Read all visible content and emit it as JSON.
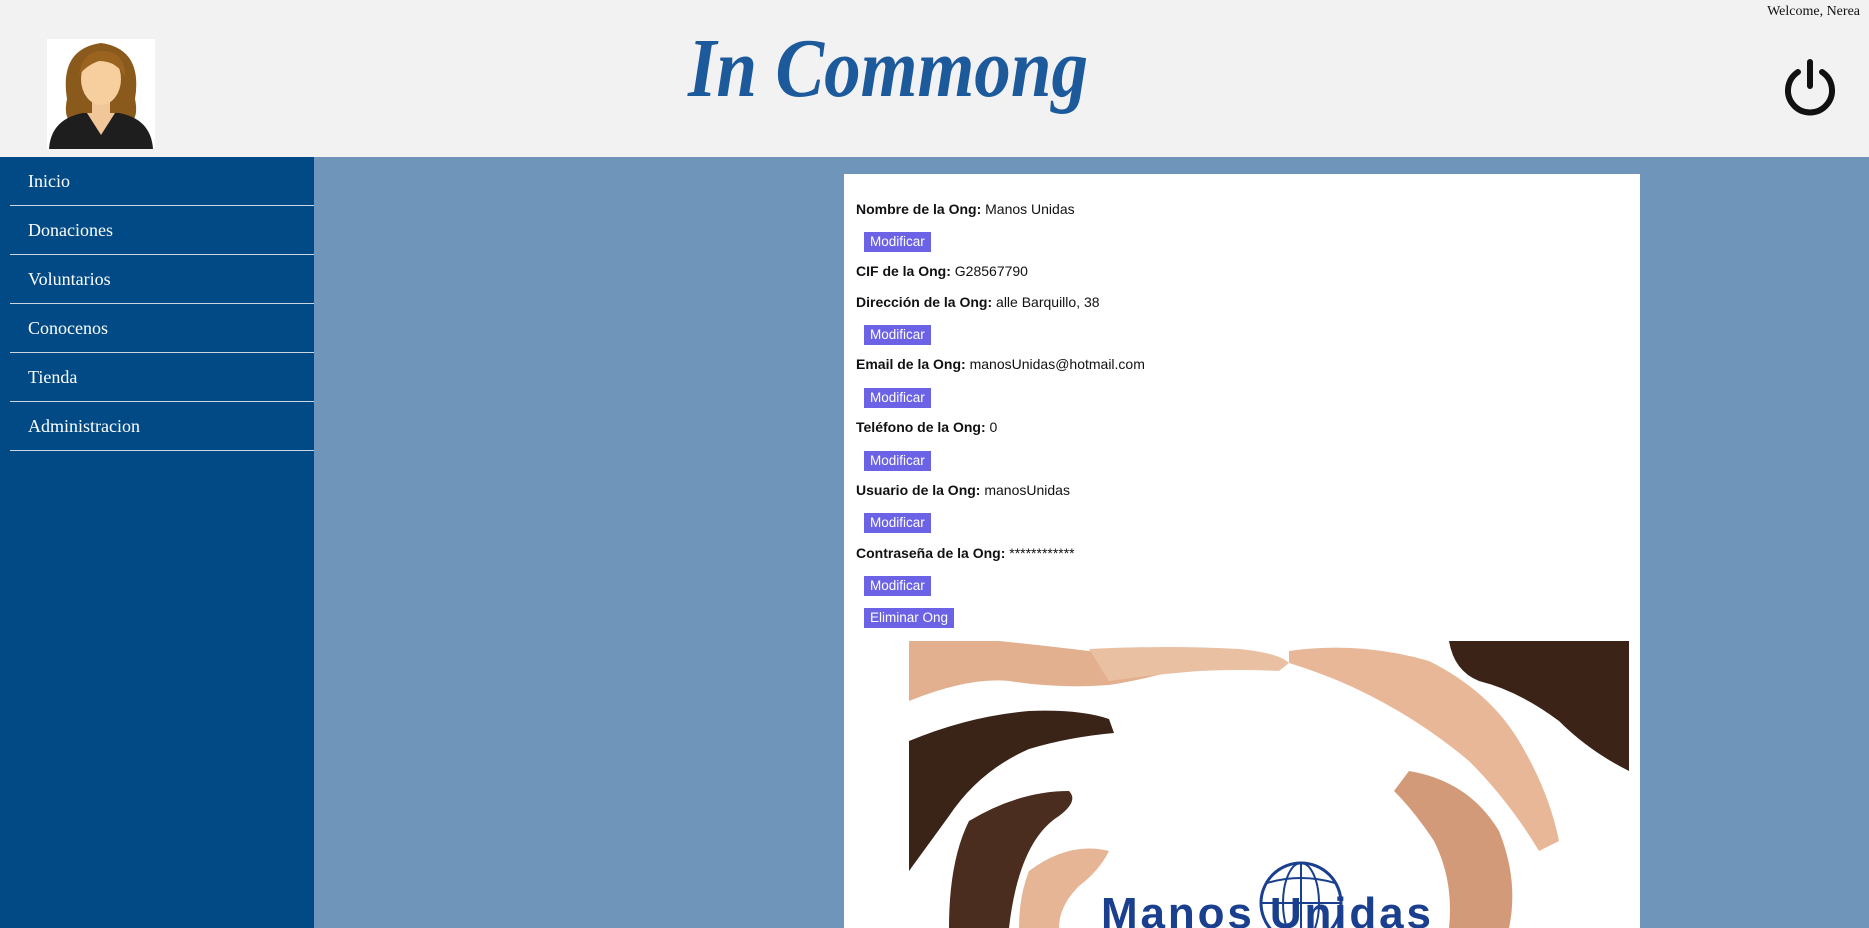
{
  "header": {
    "welcome": "Welcome, Nerea",
    "logo_text": "In Commong"
  },
  "sidebar": {
    "items": [
      {
        "label": "Inicio"
      },
      {
        "label": "Donaciones"
      },
      {
        "label": "Voluntarios"
      },
      {
        "label": "Conocenos"
      },
      {
        "label": "Tienda"
      },
      {
        "label": "Administracion"
      }
    ]
  },
  "ong": {
    "name_label": "Nombre de la Ong:",
    "name_value": "Manos Unidas",
    "cif_label": "CIF de la Ong:",
    "cif_value": "G28567790",
    "address_label": "Dirección de la Ong:",
    "address_value": "alle Barquillo, 38",
    "email_label": "Email de la Ong:",
    "email_value": "manosUnidas@hotmail.com",
    "phone_label": "Teléfono de la Ong:",
    "phone_value": "0",
    "user_label": "Usuario de la Ong:",
    "user_value": "manosUnidas",
    "password_label": "Contraseña de la Ong:",
    "password_value": "************",
    "modify_label": "Modificar",
    "delete_label": "Eliminar Ong"
  },
  "image": {
    "logo_text": "Manos Unidas"
  },
  "colors": {
    "header_bg": "#f2f2f2",
    "sidebar_bg": "#014a85",
    "page_bg": "#7095bb",
    "button_bg": "#6b62e6",
    "logo_blue": "#1c5a9c"
  }
}
